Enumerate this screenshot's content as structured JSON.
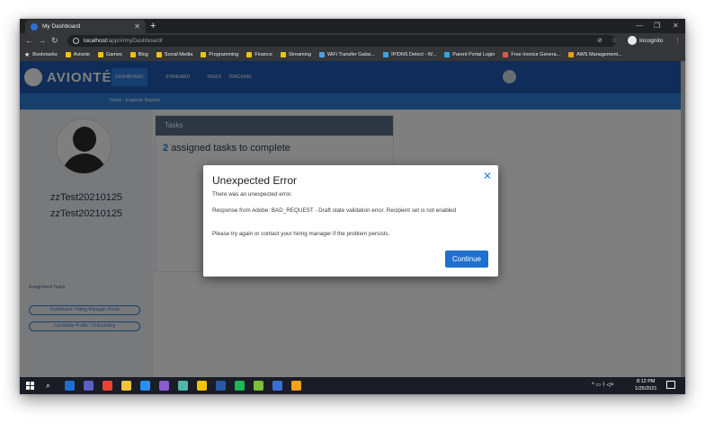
{
  "browser": {
    "tab_title": "My Dashboard",
    "new_tab": "+",
    "url_host": "localhost",
    "url_path": "/app/#/myDashboard/",
    "incognito_label": "Incognito",
    "bookmarks": [
      {
        "label": "Bookmarks",
        "color": "#e8eaed"
      },
      {
        "label": "Avionte",
        "color": "#f4c20d"
      },
      {
        "label": "Games",
        "color": "#f4c20d"
      },
      {
        "label": "Blog",
        "color": "#f4c20d"
      },
      {
        "label": "Social Media",
        "color": "#f4c20d"
      },
      {
        "label": "Programming",
        "color": "#f4c20d"
      },
      {
        "label": "Finance",
        "color": "#f4c20d"
      },
      {
        "label": "Streaming",
        "color": "#f4c20d"
      },
      {
        "label": "WiFi Transfer Galax...",
        "color": "#4aa3df"
      },
      {
        "label": "IP/DNS Detect - W...",
        "color": "#35a7e0"
      },
      {
        "label": "Parent Portal Login",
        "color": "#35a7e0"
      },
      {
        "label": "Free Invoice Genera...",
        "color": "#e2574c"
      },
      {
        "label": "AWS Management...",
        "color": "#f39c12"
      }
    ]
  },
  "app": {
    "logo": "AVIONTÉ",
    "nav_tabs": [
      "DASHBOARD",
      "STANDARD",
      "TASKS",
      "TRACKING"
    ],
    "breadcrumb": "Home › Expense Reports",
    "user_name_line1": "zzTest20210125",
    "user_name_line2": "zzTest20210125",
    "side_section": "Assignment Tasks",
    "side_buttons": [
      "Dashboard / Hiring Manager Portal",
      "Candidate Profile / Onboarding"
    ],
    "tasks_header": "Tasks",
    "tasks_count": "2",
    "tasks_text": "assigned tasks to complete"
  },
  "modal": {
    "title": "Unexpected Error",
    "close_glyph": "✕",
    "line1": "There was an unexpected error.",
    "line2": "Response from Adobe: BAD_REQUEST - Draft state validation error. Recipient set is not enabled",
    "line3": "Please try again or contact your hiring manager if the problem persists.",
    "continue_label": "Continue"
  },
  "taskbar": {
    "time": "8:12 PM",
    "date": "1/25/2021",
    "icons": [
      {
        "name": "outlook-icon",
        "color": "#1e6fd0"
      },
      {
        "name": "teams-icon",
        "color": "#5b5fc7"
      },
      {
        "name": "chrome-icon",
        "color": "#ea4335"
      },
      {
        "name": "file-explorer-icon",
        "color": "#f2c23a"
      },
      {
        "name": "vscode-icon",
        "color": "#2a8ff0"
      },
      {
        "name": "visual-studio-icon",
        "color": "#8a5bd3"
      },
      {
        "name": "app-icon-teal",
        "color": "#4fb7a8"
      },
      {
        "name": "app-icon-yellow",
        "color": "#f5c400"
      },
      {
        "name": "powershell-icon",
        "color": "#2a5aa8"
      },
      {
        "name": "spotify-icon",
        "color": "#1db954"
      },
      {
        "name": "app-icon-green",
        "color": "#7bbf3a"
      },
      {
        "name": "app-icon-blue",
        "color": "#3a6fd8"
      },
      {
        "name": "chrome-alt-icon",
        "color": "#f2a21c"
      }
    ]
  }
}
